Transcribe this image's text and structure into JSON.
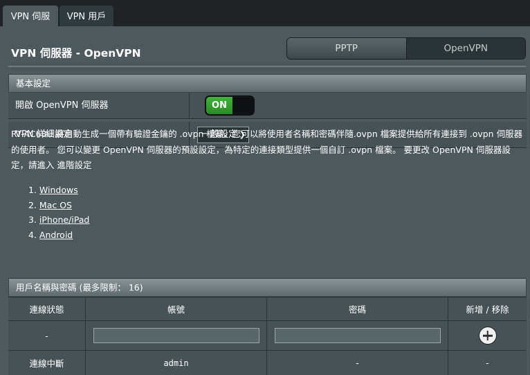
{
  "tabs": [
    {
      "label": "VPN 伺服器"
    },
    {
      "label": "VPN 用戶端"
    }
  ],
  "header": {
    "title": "VPN 伺服器 - OpenVPN",
    "segment": [
      "PPTP",
      "OpenVPN"
    ]
  },
  "basic": {
    "section_title": "基本設定",
    "enable_label": "開啟 OpenVPN 伺服器",
    "toggle_state": "ON",
    "advanced_label": "VPN 詳細設定",
    "advanced_value": "一般設定"
  },
  "description": "RT-AC68U 將自動生成一個帶有驗證金鑰的 .ovpn 檔案。您可以將使用者名稱和密碼伴隨.ovpn 檔案提供給所有連接到 .ovpn 伺服器的使用者。 您可以變更 OpenVPN 伺服器的預設設定，為特定的連接類型提供一個自訂 .ovpn 檔案。 要更改 OpenVPN 伺服器設定，請進入 進階設定",
  "os_links": [
    "Windows",
    "Mac OS",
    "iPhone/iPad",
    "Android"
  ],
  "users": {
    "section_title": "用戶名稱與密碼 (最多限制： 16)",
    "columns": [
      "連線狀態",
      "帳號",
      "密碼",
      "新增 / 移除"
    ],
    "new_row_status": "-",
    "rows": [
      {
        "status": "連線中斷",
        "account": "admin",
        "password": "-",
        "action": "-"
      }
    ]
  }
}
